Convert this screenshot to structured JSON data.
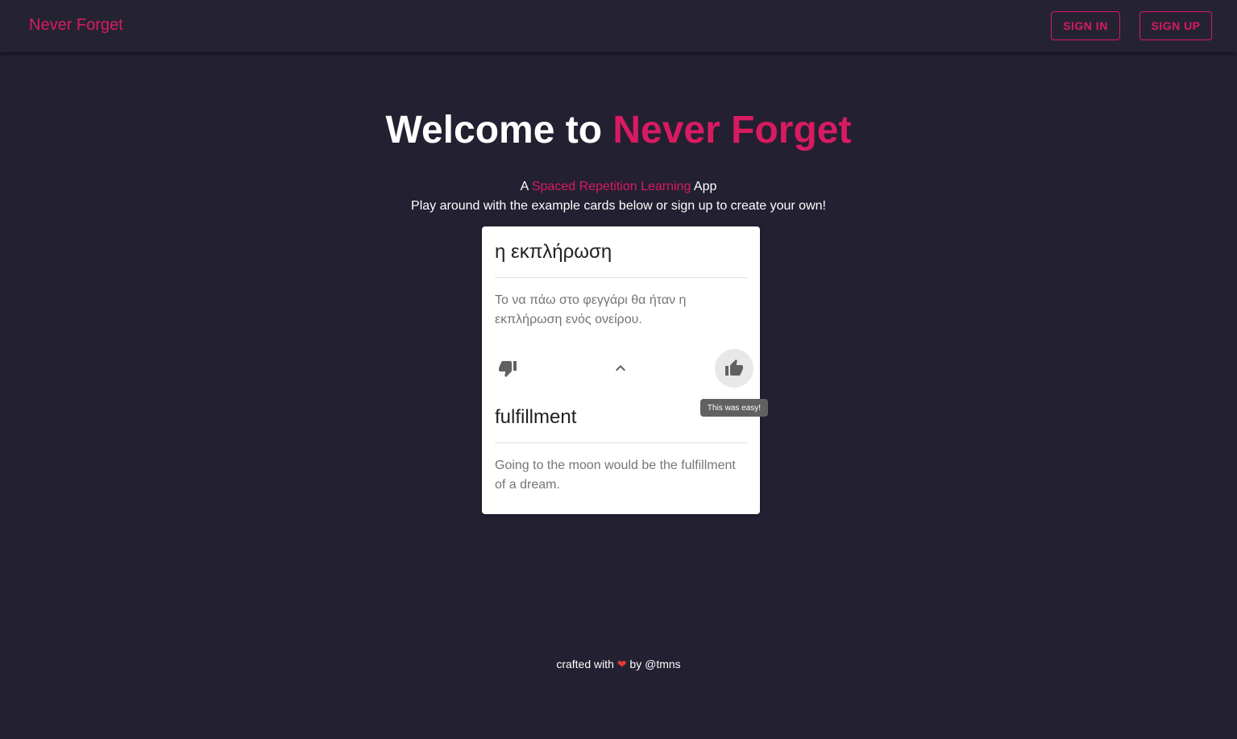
{
  "appbar": {
    "brand": "Never Forget",
    "signin_label": "SIGN IN",
    "signup_label": "SIGN UP",
    "accent_color": "#d81b60"
  },
  "hero": {
    "title_prefix": "Welcome to ",
    "title_accent": "Never Forget",
    "tagline_prefix": "A ",
    "tagline_accent": "Spaced Repetition Learning",
    "tagline_suffix": " App",
    "subtitle": "Play around with the example cards below or sign up to create your own!"
  },
  "card": {
    "front_word": "η εκπλήρωση",
    "front_example": "Το να πάω στο φεγγάρι θα ήταν η εκπλήρωση ενός ονείρου.",
    "back_word": "fulfillment",
    "back_example": "Going to the moon would be the fulfillment of a dream.",
    "icons": {
      "dislike": "thumb-down-icon",
      "expand": "chevron-up-icon",
      "like": "thumb-up-icon"
    },
    "tooltip": "This was easy!"
  },
  "footer": {
    "prefix": "crafted with ",
    "heart": "❤",
    "suffix": " by @tmns"
  }
}
